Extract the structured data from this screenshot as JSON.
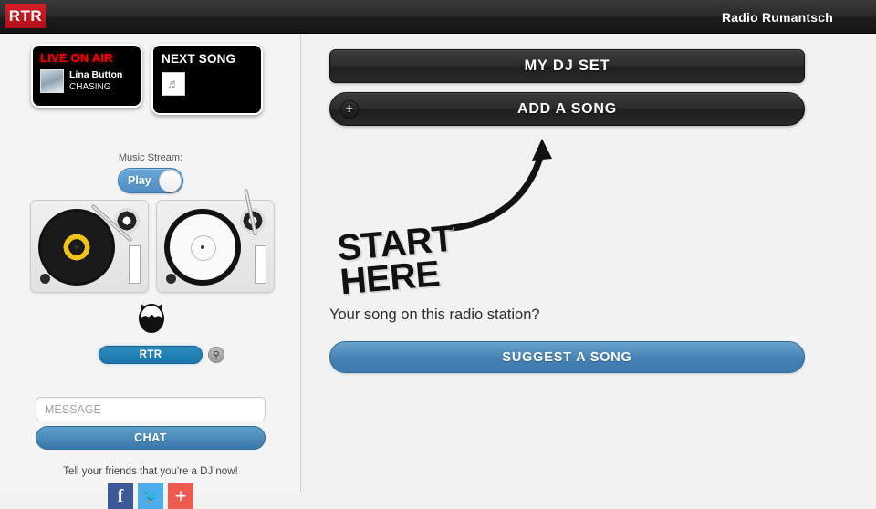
{
  "header": {
    "logo_text": "RTR",
    "title": "Radio Rumantsch",
    "logo_color": "#c8161d"
  },
  "sidebar": {
    "live_card": {
      "label": "LIVE ON AIR",
      "artist": "Lina Button",
      "song": "CHASING",
      "label_color": "#ff0000"
    },
    "next_card": {
      "label": "NEXT SONG",
      "thumb_icon": "music-placeholder-icon"
    },
    "stream": {
      "label": "Music Stream:",
      "toggle_text": "Play",
      "toggle_color": "#4f8ec4"
    },
    "decks": {
      "left_label": "turntable-loaded",
      "right_label": "turntable-empty"
    },
    "user": {
      "avatar_icon": "cat-avatar-icon",
      "name": "RTR",
      "search_icon": "search-icon"
    },
    "chat": {
      "message_placeholder": "MESSAGE",
      "message_value": "",
      "chat_button": "CHAT"
    },
    "social": {
      "text": "Tell your friends that you're a DJ now!",
      "buttons": [
        {
          "name": "facebook-share-button",
          "glyph": "f",
          "color": "#3b5998"
        },
        {
          "name": "twitter-share-button",
          "glyph": "✈",
          "color": "#4cadef"
        },
        {
          "name": "more-share-button",
          "glyph": "+",
          "color": "#ed5b4e"
        }
      ]
    }
  },
  "main": {
    "dj_set_button": "MY DJ SET",
    "add_song_button": "ADD A SONG",
    "add_song_icon": "plus-icon",
    "annotation": {
      "line1": "START",
      "line2": "HERE",
      "arrow": "curved-arrow-up-icon"
    },
    "suggest": {
      "heading": "Your song on this radio station?",
      "button": "SUGGEST A SONG",
      "button_color": "#4581b4"
    }
  }
}
